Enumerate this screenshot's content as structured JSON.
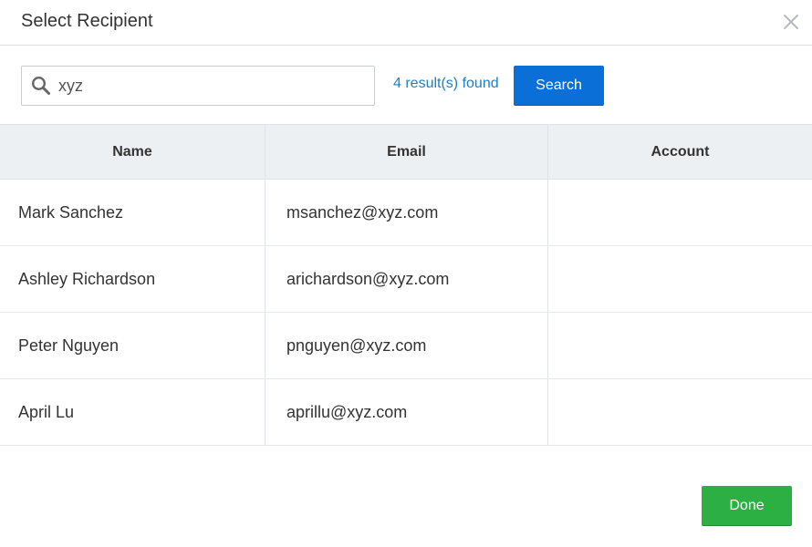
{
  "dialog": {
    "title": "Select Recipient",
    "close_icon": "close-icon"
  },
  "search": {
    "value": "xyz",
    "icon": "search-icon",
    "results_text": "4 result(s) found",
    "button_label": "Search"
  },
  "table": {
    "headers": [
      "Name",
      "Email",
      "Account"
    ],
    "rows": [
      {
        "name": "Mark Sanchez",
        "email": "msanchez@xyz.com",
        "account": ""
      },
      {
        "name": "Ashley Richardson",
        "email": "arichardson@xyz.com",
        "account": ""
      },
      {
        "name": "Peter Nguyen",
        "email": "pnguyen@xyz.com",
        "account": ""
      },
      {
        "name": "April Lu",
        "email": "aprillu@xyz.com",
        "account": ""
      }
    ]
  },
  "footer": {
    "done_label": "Done"
  },
  "colors": {
    "primary_blue": "#0a6fd6",
    "link_blue": "#1b7fcc",
    "done_green": "#2db043",
    "header_bg": "#edf0f3"
  }
}
